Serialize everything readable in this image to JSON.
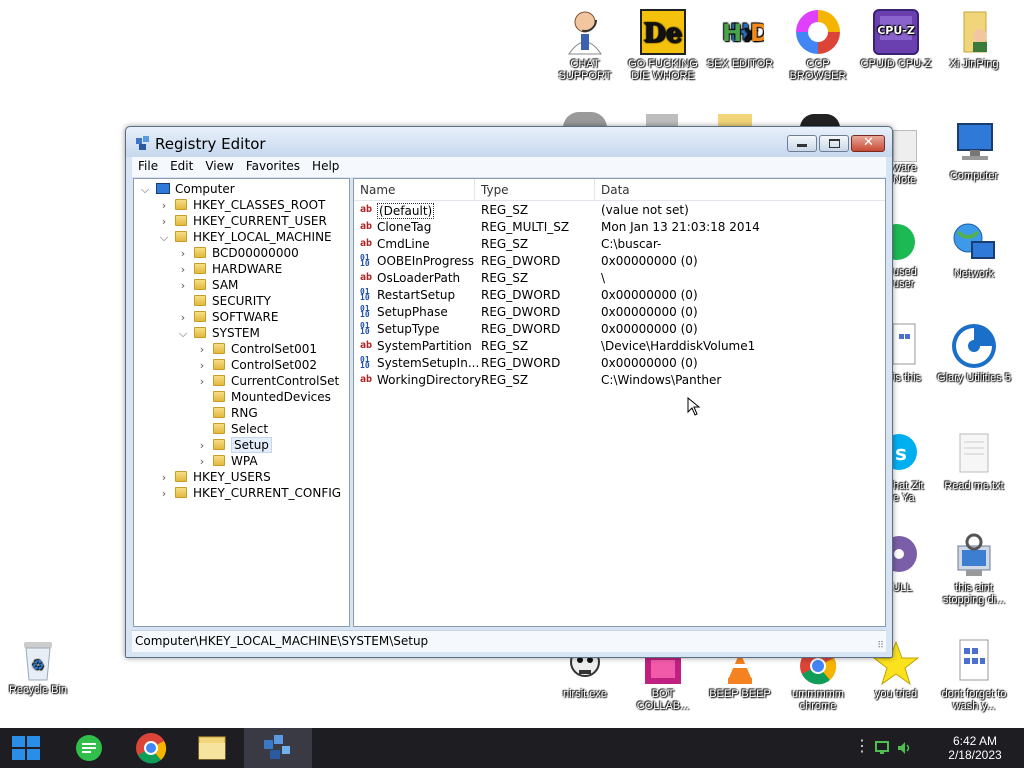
{
  "desktop": {
    "icons_top": [
      {
        "label": "CHAT SUPPORT",
        "name": "chat-support-icon"
      },
      {
        "label": "GO FUCKING DIE WHORE",
        "name": "de-app-icon"
      },
      {
        "label": "SEX EDITOR",
        "name": "hxd-editor-icon"
      },
      {
        "label": "CCP BROWSER",
        "name": "ccp-browser-icon"
      },
      {
        "label": "CPUID CPU-Z",
        "name": "cpuz-icon"
      },
      {
        "label": "Xi JinPing",
        "name": "xi-folder-icon"
      }
    ],
    "icons_right": [
      {
        "label": "Computer",
        "name": "computer-icon"
      },
      {
        "label": "Network",
        "name": "network-icon"
      },
      {
        "label": "Glary Utilities 5",
        "name": "glary-utilities-icon"
      },
      {
        "label": "Read me.txt",
        "name": "text-file-icon"
      },
      {
        "label": "this aint stopping di...",
        "name": "installer-icon"
      },
      {
        "label": "dont forget to wash y...",
        "name": "document-icon"
      }
    ],
    "partial_labels": {
      "ware_note": "ware Note",
      "used_user": "used user",
      "is_this": "is this",
      "what_zit": "hat Zit e Ya",
      "bull": "BULL"
    },
    "icons_bottom": [
      {
        "label": "nirsit.exe",
        "name": "skull-exe-icon"
      },
      {
        "label": "BOT COLLAB...",
        "name": "bot-collab-icon"
      },
      {
        "label": "BEEP BEEP",
        "name": "vlc-icon"
      },
      {
        "label": "ummmmm chrome",
        "name": "chrome-shortcut-icon"
      },
      {
        "label": "you tried",
        "name": "star-icon"
      }
    ],
    "recycle_bin": "Recycle Bin"
  },
  "window": {
    "title": "Registry Editor",
    "menu": [
      "File",
      "Edit",
      "View",
      "Favorites",
      "Help"
    ],
    "tree": [
      {
        "label": "Computer",
        "level": 0,
        "exp": "⌵"
      },
      {
        "label": "HKEY_CLASSES_ROOT",
        "level": 1,
        "exp": "›"
      },
      {
        "label": "HKEY_CURRENT_USER",
        "level": 1,
        "exp": "›"
      },
      {
        "label": "HKEY_LOCAL_MACHINE",
        "level": 1,
        "exp": "⌵"
      },
      {
        "label": "BCD00000000",
        "level": 2,
        "exp": "›"
      },
      {
        "label": "HARDWARE",
        "level": 2,
        "exp": "›"
      },
      {
        "label": "SAM",
        "level": 2,
        "exp": "›"
      },
      {
        "label": "SECURITY",
        "level": 2,
        "exp": ""
      },
      {
        "label": "SOFTWARE",
        "level": 2,
        "exp": "›"
      },
      {
        "label": "SYSTEM",
        "level": 2,
        "exp": "⌵"
      },
      {
        "label": "ControlSet001",
        "level": 3,
        "exp": "›"
      },
      {
        "label": "ControlSet002",
        "level": 3,
        "exp": "›"
      },
      {
        "label": "CurrentControlSet",
        "level": 3,
        "exp": "›"
      },
      {
        "label": "MountedDevices",
        "level": 3,
        "exp": ""
      },
      {
        "label": "RNG",
        "level": 3,
        "exp": ""
      },
      {
        "label": "Select",
        "level": 3,
        "exp": ""
      },
      {
        "label": "Setup",
        "level": 3,
        "exp": "›",
        "selected": true
      },
      {
        "label": "WPA",
        "level": 3,
        "exp": "›"
      },
      {
        "label": "HKEY_USERS",
        "level": 1,
        "exp": "›"
      },
      {
        "label": "HKEY_CURRENT_CONFIG",
        "level": 1,
        "exp": "›"
      }
    ],
    "columns": {
      "name": "Name",
      "type": "Type",
      "data": "Data"
    },
    "values": [
      {
        "name": "(Default)",
        "type": "REG_SZ",
        "data": "(value not set)",
        "kind": "sz"
      },
      {
        "name": "CloneTag",
        "type": "REG_MULTI_SZ",
        "data": "Mon Jan 13 21:03:18 2014",
        "kind": "sz"
      },
      {
        "name": "CmdLine",
        "type": "REG_SZ",
        "data": "C:\\buscar-",
        "kind": "sz"
      },
      {
        "name": "OOBEInProgress",
        "type": "REG_DWORD",
        "data": "0x00000000 (0)",
        "kind": "bin"
      },
      {
        "name": "OsLoaderPath",
        "type": "REG_SZ",
        "data": "\\",
        "kind": "sz"
      },
      {
        "name": "RestartSetup",
        "type": "REG_DWORD",
        "data": "0x00000000 (0)",
        "kind": "bin"
      },
      {
        "name": "SetupPhase",
        "type": "REG_DWORD",
        "data": "0x00000000 (0)",
        "kind": "bin"
      },
      {
        "name": "SetupType",
        "type": "REG_DWORD",
        "data": "0x00000000 (0)",
        "kind": "bin"
      },
      {
        "name": "SystemPartition",
        "type": "REG_SZ",
        "data": "\\Device\\HarddiskVolume1",
        "kind": "sz"
      },
      {
        "name": "SystemSetupIn...",
        "type": "REG_DWORD",
        "data": "0x00000000 (0)",
        "kind": "bin"
      },
      {
        "name": "WorkingDirectory",
        "type": "REG_SZ",
        "data": "C:\\Windows\\Panther",
        "kind": "sz"
      }
    ],
    "status_path": "Computer\\HKEY_LOCAL_MACHINE\\SYSTEM\\Setup"
  },
  "taskbar": {
    "time": "6:42 AM",
    "date": "2/18/2023",
    "items": [
      "start-button",
      "notes-app",
      "chrome",
      "file-explorer",
      "registry-editor"
    ]
  },
  "colors": {
    "taskbar": "#1d1d22",
    "window_frame": "#d6e4f4",
    "start_blue": "#2a8ee6"
  }
}
